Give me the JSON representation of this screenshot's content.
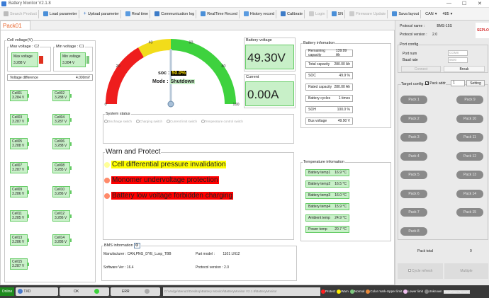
{
  "window": {
    "title": "Battery Monitor V2.1.8"
  },
  "toolbar": {
    "items": [
      "Search Product",
      "Load parameter",
      "Upload parameter",
      "Real time",
      "Communication log",
      "RealTime Record",
      "History record",
      "Calibrate",
      "Login",
      "SN",
      "Firmware Update",
      "Sava layout"
    ],
    "can_label": "CAN",
    "baud": "485"
  },
  "tab": "Pack01",
  "cell_voltage": {
    "title": "Cell voltage(V)",
    "max_label": "Max voltage : C2",
    "max_inner": "Max voltage",
    "max_value": "3.288 V",
    "min_label": "Min voltage : C1",
    "min_inner": "Min voltage",
    "min_value": "3.284 V",
    "diff_label": "Voltage difference",
    "diff_value": "4.000mV",
    "cells": [
      {
        "name": "Cell01",
        "v": "3.284 V"
      },
      {
        "name": "Cell02",
        "v": "3.288 V"
      },
      {
        "name": "Cell03",
        "v": "3.287 V"
      },
      {
        "name": "Cell04",
        "v": "3.287 V"
      },
      {
        "name": "Cell05",
        "v": "3.288 V"
      },
      {
        "name": "Cell06",
        "v": "3.288 V"
      },
      {
        "name": "Cell07",
        "v": "3.287 V"
      },
      {
        "name": "Cell08",
        "v": "3.285 V"
      },
      {
        "name": "Cell09",
        "v": "3.286 V"
      },
      {
        "name": "Cell10",
        "v": "3.286 V"
      },
      {
        "name": "Cell11",
        "v": "3.285 V"
      },
      {
        "name": "Cell12",
        "v": "3.286 V"
      },
      {
        "name": "Cell13",
        "v": "3.286 V"
      },
      {
        "name": "Cell14",
        "v": "3.286 V"
      },
      {
        "name": "Cell15",
        "v": "3.287 V"
      }
    ]
  },
  "gauge": {
    "ticks": [
      "0",
      "10",
      "20",
      "30",
      "40",
      "50",
      "60",
      "70",
      "80",
      "90",
      "100"
    ],
    "soc_label": "soc :",
    "soc_value": "50.0%",
    "mode_label": "Mode :",
    "mode_value": "Shutdown",
    "soc_fraction": 0.5
  },
  "battery_voltage": {
    "title": "Battery voltage",
    "value": "49.30V"
  },
  "current": {
    "title": "Current",
    "value": "0.00A"
  },
  "system_status": {
    "title": "System status",
    "switches": [
      "Discharge switch",
      "Charging switch",
      "Current limit switch",
      "Temperature control switch"
    ]
  },
  "warn": {
    "title": "Warn and Protect",
    "items": [
      {
        "text": "Cell differential pressure invalidation",
        "color": "#ffff00",
        "dot": "#ffff99"
      },
      {
        "text": "Monomer undervoltage protection",
        "color": "#ff0000",
        "dot": "#ff8a6a"
      },
      {
        "text": "Battery low voltage forbidden charging",
        "color": "#ff0000",
        "dot": "#ff8a6a"
      }
    ]
  },
  "bms": {
    "title": "BMS information",
    "manufacturer_label": "Manufacturer :",
    "manufacturer": "CAN,PNG_DYE_Luxp_TBB",
    "part_label": "Part model :",
    "part": "1101 LN12",
    "sw_label": "Software Ver :",
    "sw": "16.4",
    "proto_label": "Protocol version :",
    "proto": "2.0"
  },
  "battery_info": {
    "title": "Battery infomation",
    "rows": [
      {
        "k": "Remaining capacity",
        "v": "139.99 Ah"
      },
      {
        "k": "Total capacity",
        "v": "280.00 Ah"
      },
      {
        "k": "SOC",
        "v": "49.9 %"
      },
      {
        "k": "Rated capacity",
        "v": "280.00 Ah"
      },
      {
        "k": "Battery cycles",
        "v": "1 times"
      },
      {
        "k": "SOH",
        "v": "100.0 %"
      },
      {
        "k": "Bus voltage",
        "v": "49.90 V"
      }
    ]
  },
  "temperature": {
    "title": "Temperature infomation",
    "rows": [
      {
        "k": "Battery temp1",
        "v": "16.9 °C"
      },
      {
        "k": "Battery temp2",
        "v": "16.5 °C"
      },
      {
        "k": "Battery temp3",
        "v": "16.0 °C"
      },
      {
        "k": "Battery temp4",
        "v": "15.9 °C"
      },
      {
        "k": "Ambient temp",
        "v": "24.9 °C"
      },
      {
        "k": "Power temp",
        "v": "20.7 °C"
      }
    ]
  },
  "right": {
    "protocol_name_label": "Protocol name :",
    "protocol_name": "BMS-15S",
    "protocol_version_label": "Protocol version :",
    "protocol_version": "2.0",
    "logo": "SEPLOS",
    "port_config": "Port config",
    "port_num_label": "Port num",
    "port_num": "COM8",
    "baud_label": "Baud rate",
    "baud": "9600",
    "connect": "Connect",
    "break": "Break",
    "target_config": "Target config",
    "pack_addr_label": "Pack addr",
    "pack_addr": "1",
    "setting": "Setting",
    "packs": [
      "Pack 1",
      "Pack 9",
      "Pack 2",
      "Pack 10",
      "Pack 3",
      "Pack 11",
      "Pack 4",
      "Pack 12",
      "Pack 5",
      "Pack 13",
      "Pack 6",
      "Pack 14",
      "Pack 7",
      "Pack 15",
      "Pack 8"
    ],
    "pack_total_label": "Pack total",
    "pack_total": "0",
    "cycle_refresh": "Cycle refresh",
    "multiple": "Multiple"
  },
  "statusbar": {
    "online": "Online",
    "txd": "TXD",
    "ok": "OK",
    "err": "ERR",
    "path": "D:\\Vedge\\Benutz\\Desktop\\Battery Monitor\\BatteryMonitor V2.1.8\\BatteryMonitor",
    "legend": [
      {
        "label": "Protect",
        "color": "#ff2020"
      },
      {
        "label": "Warn",
        "color": "#ffee00"
      },
      {
        "label": "Normal",
        "color": "#7ec87e"
      },
      {
        "label": "Color mark-Upper limit",
        "color": "#e88a3c"
      },
      {
        "label": "Lower limit",
        "color": "#f0c0f0"
      },
      {
        "label": "Unknown",
        "color": "#888888"
      }
    ],
    "rt": "RealTime Record"
  }
}
